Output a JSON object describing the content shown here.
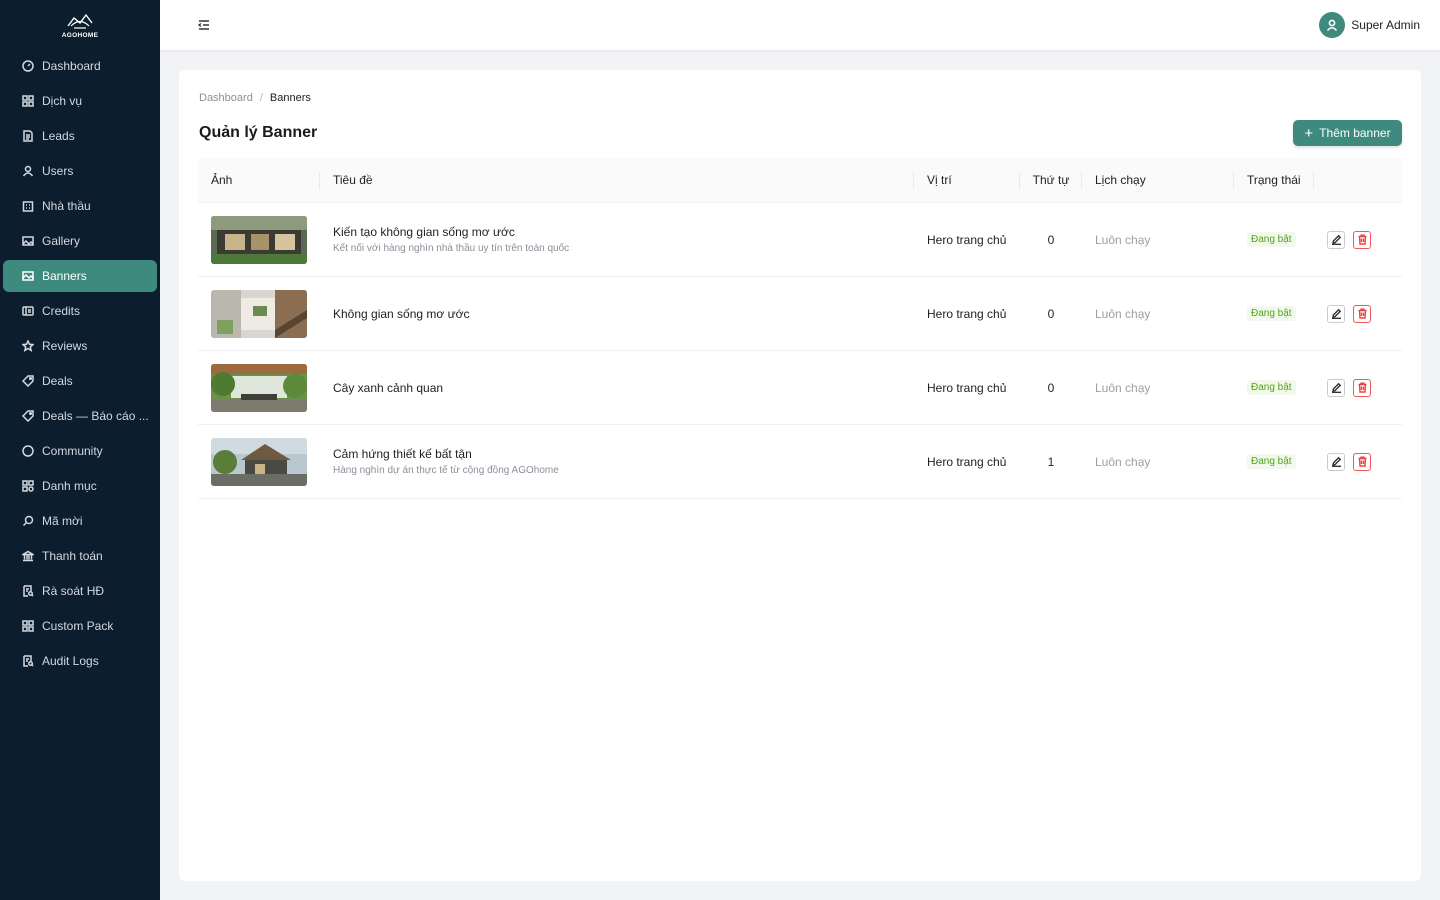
{
  "brand": {
    "name": "AGOHOME",
    "accent": "#3e8a7e",
    "sidebar_bg": "#0c1d2e"
  },
  "sidebar": {
    "items": [
      {
        "label": "Dashboard",
        "icon": "dashboard-icon"
      },
      {
        "label": "Dịch vụ",
        "icon": "grid-icon"
      },
      {
        "label": "Leads",
        "icon": "document-icon"
      },
      {
        "label": "Users",
        "icon": "user-icon"
      },
      {
        "label": "Nhà thầu",
        "icon": "building-icon"
      },
      {
        "label": "Gallery",
        "icon": "image-icon"
      },
      {
        "label": "Banners",
        "icon": "banner-icon",
        "active": true
      },
      {
        "label": "Credits",
        "icon": "wallet-icon"
      },
      {
        "label": "Reviews",
        "icon": "star-icon"
      },
      {
        "label": "Deals",
        "icon": "tag-icon"
      },
      {
        "label": "Deals — Báo cáo ...",
        "icon": "tag-icon"
      },
      {
        "label": "Community",
        "icon": "chat-icon"
      },
      {
        "label": "Danh mục",
        "icon": "category-icon"
      },
      {
        "label": "Mã mời",
        "icon": "search-icon"
      },
      {
        "label": "Thanh toán",
        "icon": "bank-icon"
      },
      {
        "label": "Rà soát HĐ",
        "icon": "review-doc-icon"
      },
      {
        "label": "Custom Pack",
        "icon": "grid-icon"
      },
      {
        "label": "Audit Logs",
        "icon": "review-doc-icon"
      }
    ]
  },
  "header": {
    "user_name": "Super Admin"
  },
  "breadcrumb": {
    "root": "Dashboard",
    "separator": "/",
    "current": "Banners"
  },
  "page": {
    "title": "Quản lý Banner",
    "add_button": "Thêm banner"
  },
  "table": {
    "columns": [
      "Ảnh",
      "Tiêu đề",
      "Vị trí",
      "Thứ tự",
      "Lịch chạy",
      "Trạng thái"
    ],
    "rows": [
      {
        "title": "Kiến tạo không gian sống mơ ước",
        "subtitle": "Kết nối với hàng nghìn nhà thầu uy tín trên toàn quốc",
        "position": "Hero trang chủ",
        "order": "0",
        "schedule": "Luôn chạy",
        "status": "Đang bật"
      },
      {
        "title": "Không gian sống mơ ước",
        "subtitle": "",
        "position": "Hero trang chủ",
        "order": "0",
        "schedule": "Luôn chạy",
        "status": "Đang bật"
      },
      {
        "title": "Cây xanh cảnh quan",
        "subtitle": "",
        "position": "Hero trang chủ",
        "order": "0",
        "schedule": "Luôn chạy",
        "status": "Đang bật"
      },
      {
        "title": "Cảm hứng thiết kế bất tận",
        "subtitle": "Hàng nghìn dự án thực tế từ cộng đồng AGOhome",
        "position": "Hero trang chủ",
        "order": "1",
        "schedule": "Luôn chạy",
        "status": "Đang bật"
      }
    ]
  }
}
